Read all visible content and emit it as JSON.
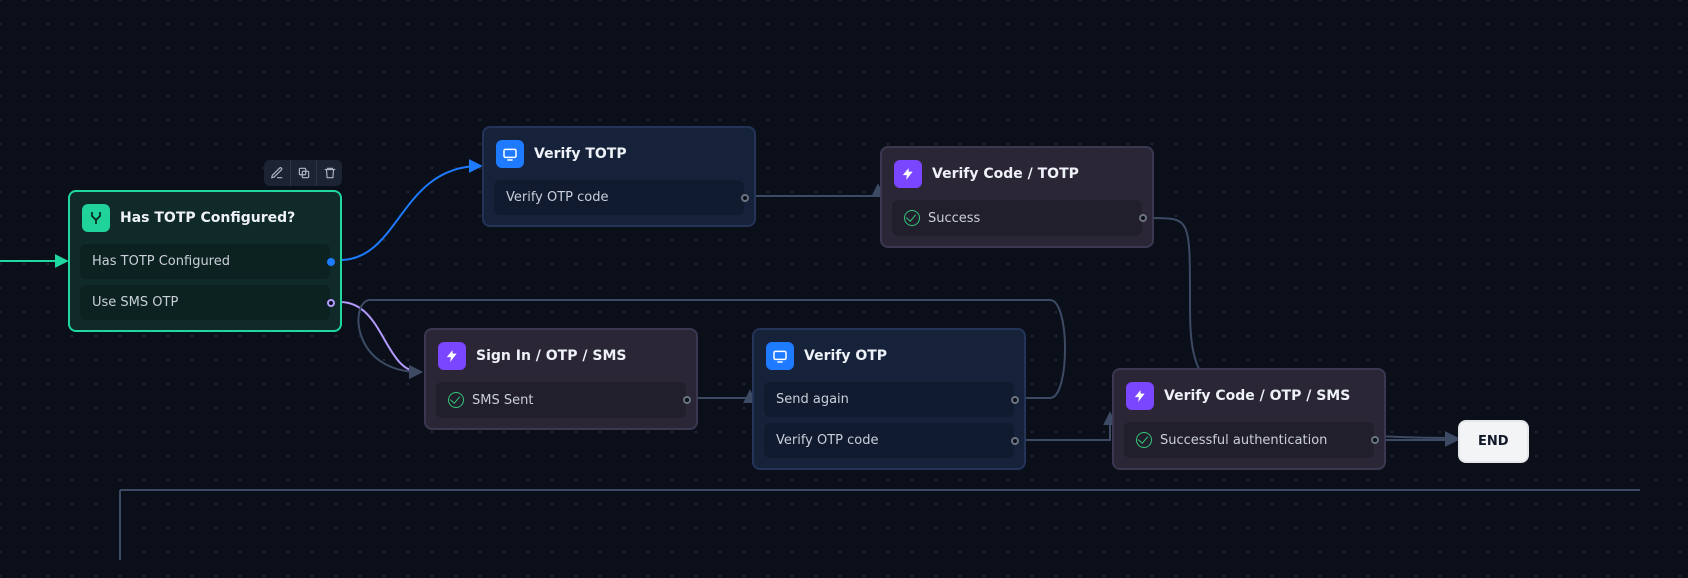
{
  "diagram": {
    "toolbar": {
      "edit_tooltip": "Edit",
      "copy_tooltip": "Duplicate",
      "delete_tooltip": "Delete"
    },
    "end_label": "END",
    "nodes": {
      "has_totp": {
        "title": "Has TOTP Configured?",
        "rows": [
          "Has TOTP Configured",
          "Use SMS OTP"
        ]
      },
      "verify_totp": {
        "title": "Verify TOTP",
        "rows": [
          "Verify OTP code"
        ]
      },
      "verify_code_totp": {
        "title": "Verify Code / TOTP",
        "rows": [
          "Success"
        ]
      },
      "sign_in_sms": {
        "title": "Sign In / OTP / SMS",
        "rows": [
          "SMS Sent"
        ]
      },
      "verify_otp": {
        "title": "Verify OTP",
        "rows": [
          "Send again",
          "Verify OTP code"
        ]
      },
      "verify_code_sms": {
        "title": "Verify Code / OTP / SMS",
        "rows": [
          "Successful authentication"
        ]
      }
    },
    "colors": {
      "condition_border": "#20d7a0",
      "blue": "#1e7bff",
      "purple_light": "#b39bff",
      "edge_default": "#3d4a63"
    }
  }
}
